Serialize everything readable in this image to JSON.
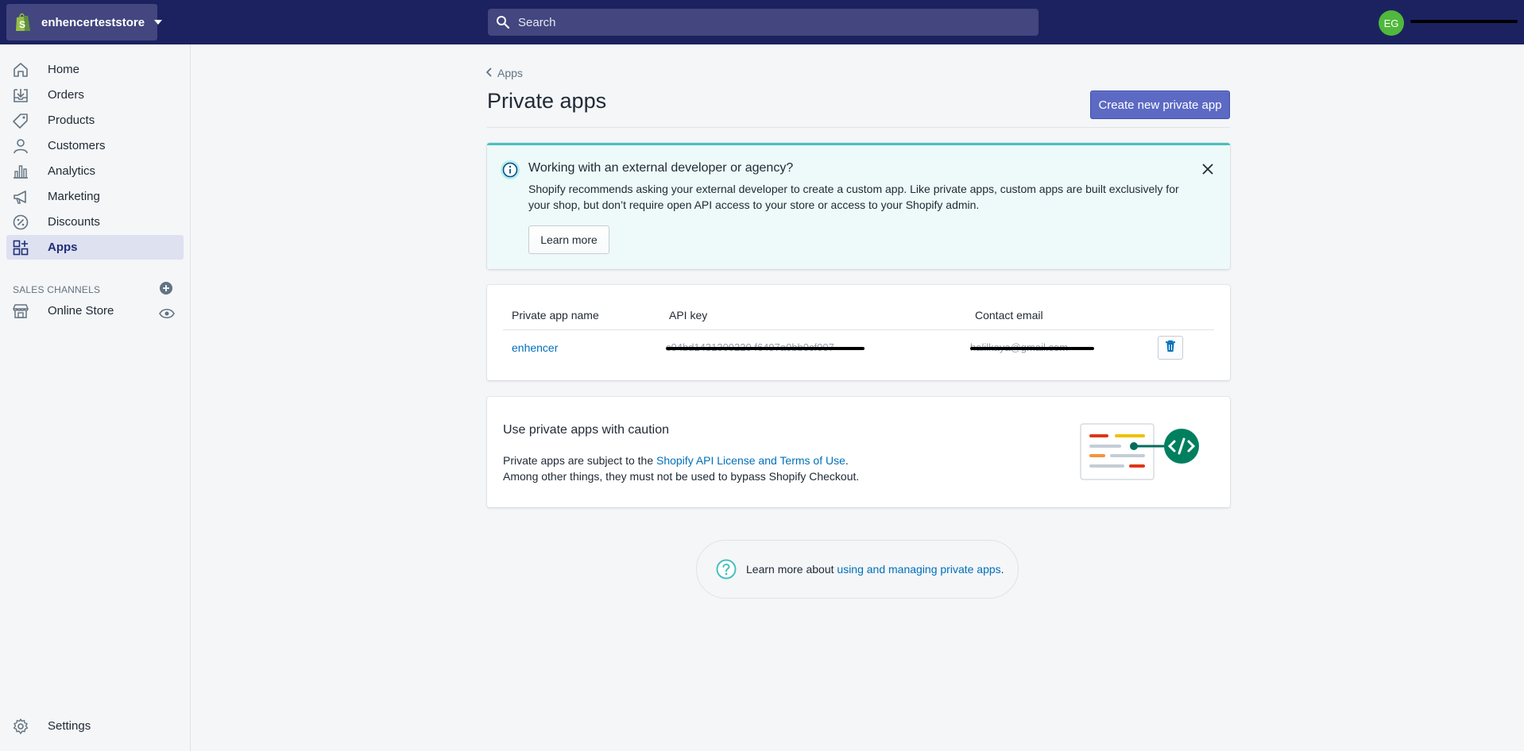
{
  "topbar": {
    "store_name": "enhencerteststore",
    "search_placeholder": "Search",
    "avatar_initials": "EG",
    "brand_color": "#1c2260"
  },
  "sidebar": {
    "items": [
      {
        "label": "Home",
        "icon": "home-icon"
      },
      {
        "label": "Orders",
        "icon": "orders-icon"
      },
      {
        "label": "Products",
        "icon": "tag-icon"
      },
      {
        "label": "Customers",
        "icon": "person-icon"
      },
      {
        "label": "Analytics",
        "icon": "bar-chart-icon"
      },
      {
        "label": "Marketing",
        "icon": "megaphone-icon"
      },
      {
        "label": "Discounts",
        "icon": "percent-icon"
      },
      {
        "label": "Apps",
        "icon": "apps-icon",
        "active": true
      }
    ],
    "sales_channels_label": "SALES CHANNELS",
    "online_store_label": "Online Store",
    "settings_label": "Settings"
  },
  "main": {
    "breadcrumb": "Apps",
    "title": "Private apps",
    "create_button": "Create new private app",
    "banner": {
      "title": "Working with an external developer or agency?",
      "text": "Shopify recommends asking your external developer to create a custom app. Like private apps, custom apps are built exclusively for your shop, but don’t require open API access to your store or access to your Shopify admin.",
      "button": "Learn more",
      "accent_color": "#47c1bf"
    },
    "table": {
      "headers": [
        "Private app name",
        "API key",
        "Contact email"
      ],
      "rows": [
        {
          "name": "enhencer",
          "api_key": "c04bd1431300220 f6497a0bb0cf007",
          "email": "halilkaya@gmail.com"
        }
      ]
    },
    "caution": {
      "title": "Use private apps with caution",
      "line1_prefix": "Private apps are subject to the ",
      "line1_link": "Shopify API License and Terms of Use",
      "line1_suffix": ".",
      "line2": "Among other things, they must not be used to bypass Shopify Checkout."
    },
    "footer": {
      "prefix": "Learn more about ",
      "link": "using and managing private apps",
      "suffix": "."
    }
  }
}
